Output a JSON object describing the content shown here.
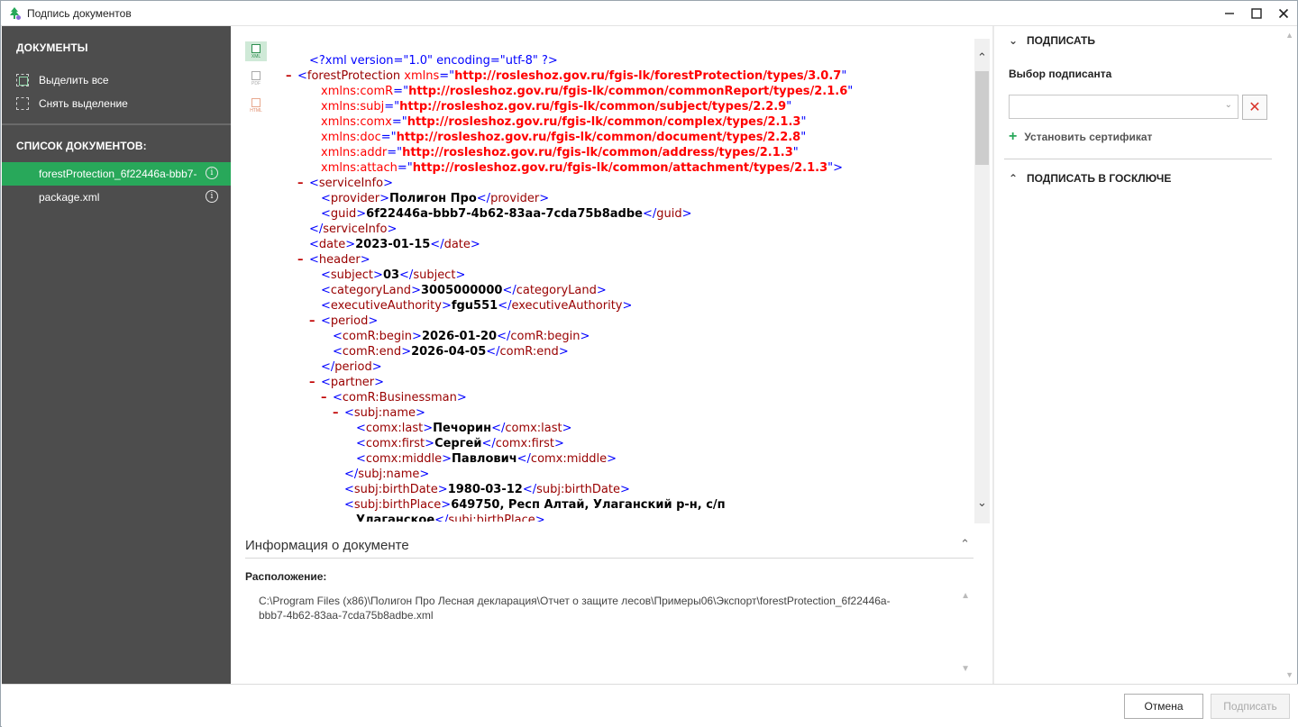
{
  "window": {
    "title": "Подпись документов"
  },
  "sidebar": {
    "documents_heading": "ДОКУМЕНТЫ",
    "select_all": "Выделить все",
    "deselect": "Снять выделение",
    "list_heading": "СПИСОК ДОКУМЕНТОВ:",
    "items": [
      {
        "label": "forestProtection_6f22446a-bbb7-",
        "active": true
      },
      {
        "label": "package.xml",
        "active": false
      }
    ]
  },
  "viewer": {
    "formats": [
      "XML",
      "PDF",
      "HTML"
    ],
    "xml_lines": [
      {
        "t": "<?xml version=\"1.0\" encoding=\"utf-8\" ?>"
      },
      {
        "t": "<forestProtection xmlns=\"http://rosleshoz.gov.ru/fgis-lk/forestProtection/types/3.0.7\""
      },
      {
        "t": "xmlns:comR=\"http://rosleshoz.gov.ru/fgis-lk/common/commonReport/types/2.1.6\""
      },
      {
        "t": "xmlns:subj=\"http://rosleshoz.gov.ru/fgis-lk/common/subject/types/2.2.9\""
      },
      {
        "t": "xmlns:comx=\"http://rosleshoz.gov.ru/fgis-lk/common/complex/types/2.1.3\""
      },
      {
        "t": "xmlns:doc=\"http://rosleshoz.gov.ru/fgis-lk/common/document/types/2.2.8\""
      },
      {
        "t": "xmlns:addr=\"http://rosleshoz.gov.ru/fgis-lk/common/address/types/2.1.3\""
      },
      {
        "t": "xmlns:attach=\"http://rosleshoz.gov.ru/fgis-lk/common/attachment/types/2.1.3\">"
      },
      {
        "t": "<serviceInfo>"
      },
      {
        "t": "<provider>Полигон Про</provider>"
      },
      {
        "t": "<guid>6f22446a-bbb7-4b62-83aa-7cda75b8adbe</guid>"
      },
      {
        "t": "</serviceInfo>"
      },
      {
        "t": "<date>2023-01-15</date>"
      },
      {
        "t": "<header>"
      },
      {
        "t": "<subject>03</subject>"
      },
      {
        "t": "<categoryLand>3005000000</categoryLand>"
      },
      {
        "t": "<executiveAuthority>fgu551</executiveAuthority>"
      },
      {
        "t": "<period>"
      },
      {
        "t": "<comR:begin>2026-01-20</comR:begin>"
      },
      {
        "t": "<comR:end>2026-04-05</comR:end>"
      },
      {
        "t": "</period>"
      },
      {
        "t": "<partner>"
      },
      {
        "t": "<comR:Businessman>"
      },
      {
        "t": "<subj:name>"
      },
      {
        "t": "<comx:last>Печорин</comx:last>"
      },
      {
        "t": "<comx:first>Сергей</comx:first>"
      },
      {
        "t": "<comx:middle>Павлович</comx:middle>"
      },
      {
        "t": "</subj:name>"
      },
      {
        "t": "<subj:birthDate>1980-03-12</subj:birthDate>"
      },
      {
        "t": "<subj:birthPlace>649750, Респ Алтай, Улаганский р-н, с/п"
      },
      {
        "t": "Улаганское</subj:birthPlace>"
      }
    ]
  },
  "doc_info": {
    "title": "Информация о документе",
    "location_label": "Расположение:",
    "location_path": "C:\\Program Files (x86)\\Полигон Про Лесная декларация\\Отчет о защите лесов\\Примеры06\\Экспорт\\forestProtection_6f22446a-bbb7-4b62-83aa-7cda75b8adbe.xml"
  },
  "sign_panel": {
    "sign_heading": "ПОДПИСАТЬ",
    "signer_label": "Выбор подписанта",
    "signer_value": "",
    "install_cert": "Установить сертификат",
    "goskey_heading": "ПОДПИСАТЬ В ГОСКЛЮЧЕ"
  },
  "footer": {
    "cancel": "Отмена",
    "sign": "Подписать"
  },
  "colors": {
    "sidebar_bg": "#4d4d4d",
    "accent_green": "#28a85a",
    "xml_tag": "#990000",
    "xml_attr_value": "#ff0000",
    "xml_punct": "#0000ff"
  }
}
